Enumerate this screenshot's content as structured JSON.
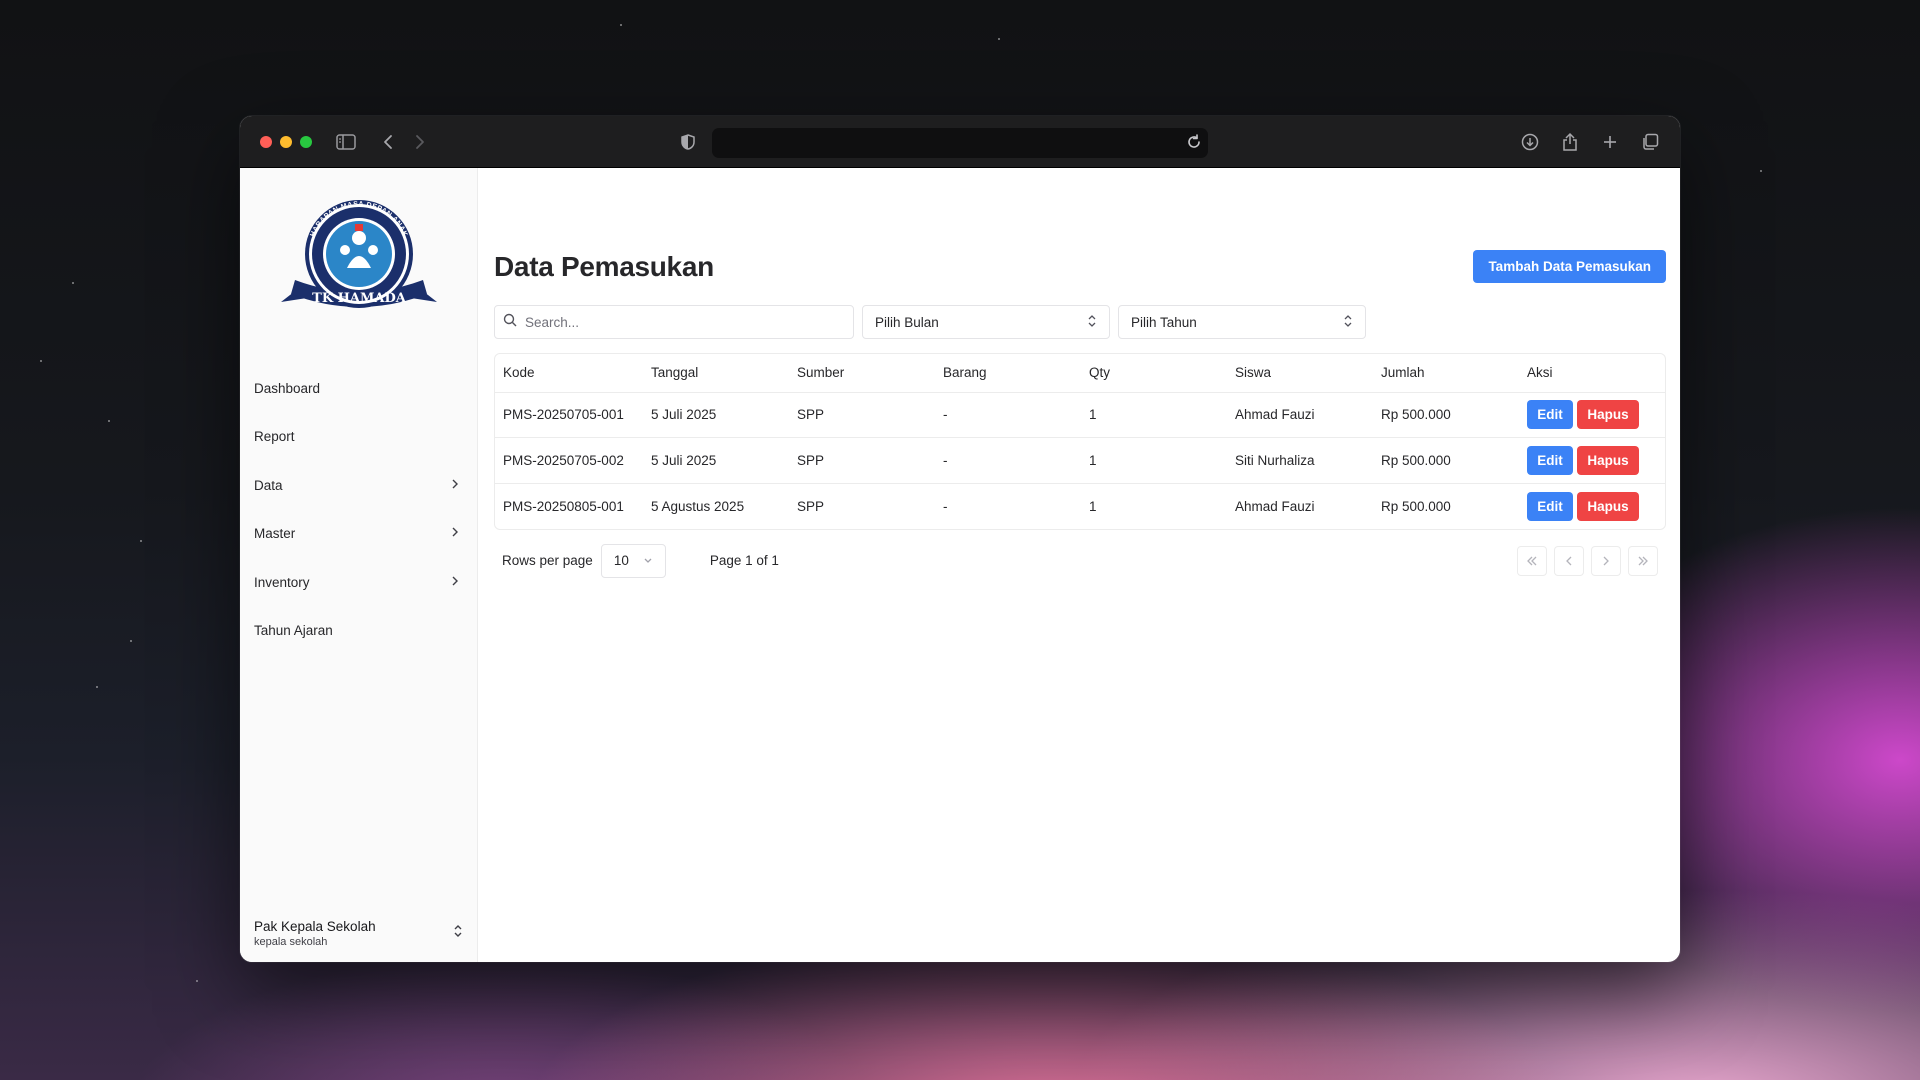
{
  "sidebar": {
    "logo": {
      "arc_text": "HARAPAN MASA DEPAN ANAK",
      "inner_text": "CERDAS CERIA SEHAT KUAT BERBUDI",
      "ribbon": "TK HAMADA"
    },
    "items": [
      {
        "label": "Dashboard",
        "has_chevron": false
      },
      {
        "label": "Report",
        "has_chevron": false
      },
      {
        "label": "Data",
        "has_chevron": true
      },
      {
        "label": "Master",
        "has_chevron": true
      },
      {
        "label": "Inventory",
        "has_chevron": true
      },
      {
        "label": "Tahun Ajaran",
        "has_chevron": false
      }
    ],
    "user": {
      "name": "Pak Kepala Sekolah",
      "role": "kepala sekolah"
    }
  },
  "header": {
    "title": "Data Pemasukan",
    "add_button": "Tambah Data Pemasukan"
  },
  "filters": {
    "search_placeholder": "Search...",
    "month_select": "Pilih Bulan",
    "year_select": "Pilih Tahun"
  },
  "table": {
    "columns": [
      "Kode",
      "Tanggal",
      "Sumber",
      "Barang",
      "Qty",
      "Siswa",
      "Jumlah",
      "Aksi"
    ],
    "rows": [
      {
        "kode": "PMS-20250705-001",
        "tanggal": "5 Juli 2025",
        "sumber": "SPP",
        "barang": "-",
        "qty": "1",
        "siswa": "Ahmad Fauzi",
        "jumlah": "Rp 500.000"
      },
      {
        "kode": "PMS-20250705-002",
        "tanggal": "5 Juli 2025",
        "sumber": "SPP",
        "barang": "-",
        "qty": "1",
        "siswa": "Siti Nurhaliza",
        "jumlah": "Rp 500.000"
      },
      {
        "kode": "PMS-20250805-001",
        "tanggal": "5 Agustus 2025",
        "sumber": "SPP",
        "barang": "-",
        "qty": "1",
        "siswa": "Ahmad Fauzi",
        "jumlah": "Rp 500.000"
      }
    ],
    "edit_label": "Edit",
    "delete_label": "Hapus"
  },
  "pagination": {
    "rows_label": "Rows per page",
    "rows_value": "10",
    "page_info": "Page 1 of 1"
  },
  "colors": {
    "primary": "#3b82f6",
    "danger": "#ef4444",
    "logo_navy": "#1b2f6b",
    "logo_blue": "#2b86c8"
  }
}
